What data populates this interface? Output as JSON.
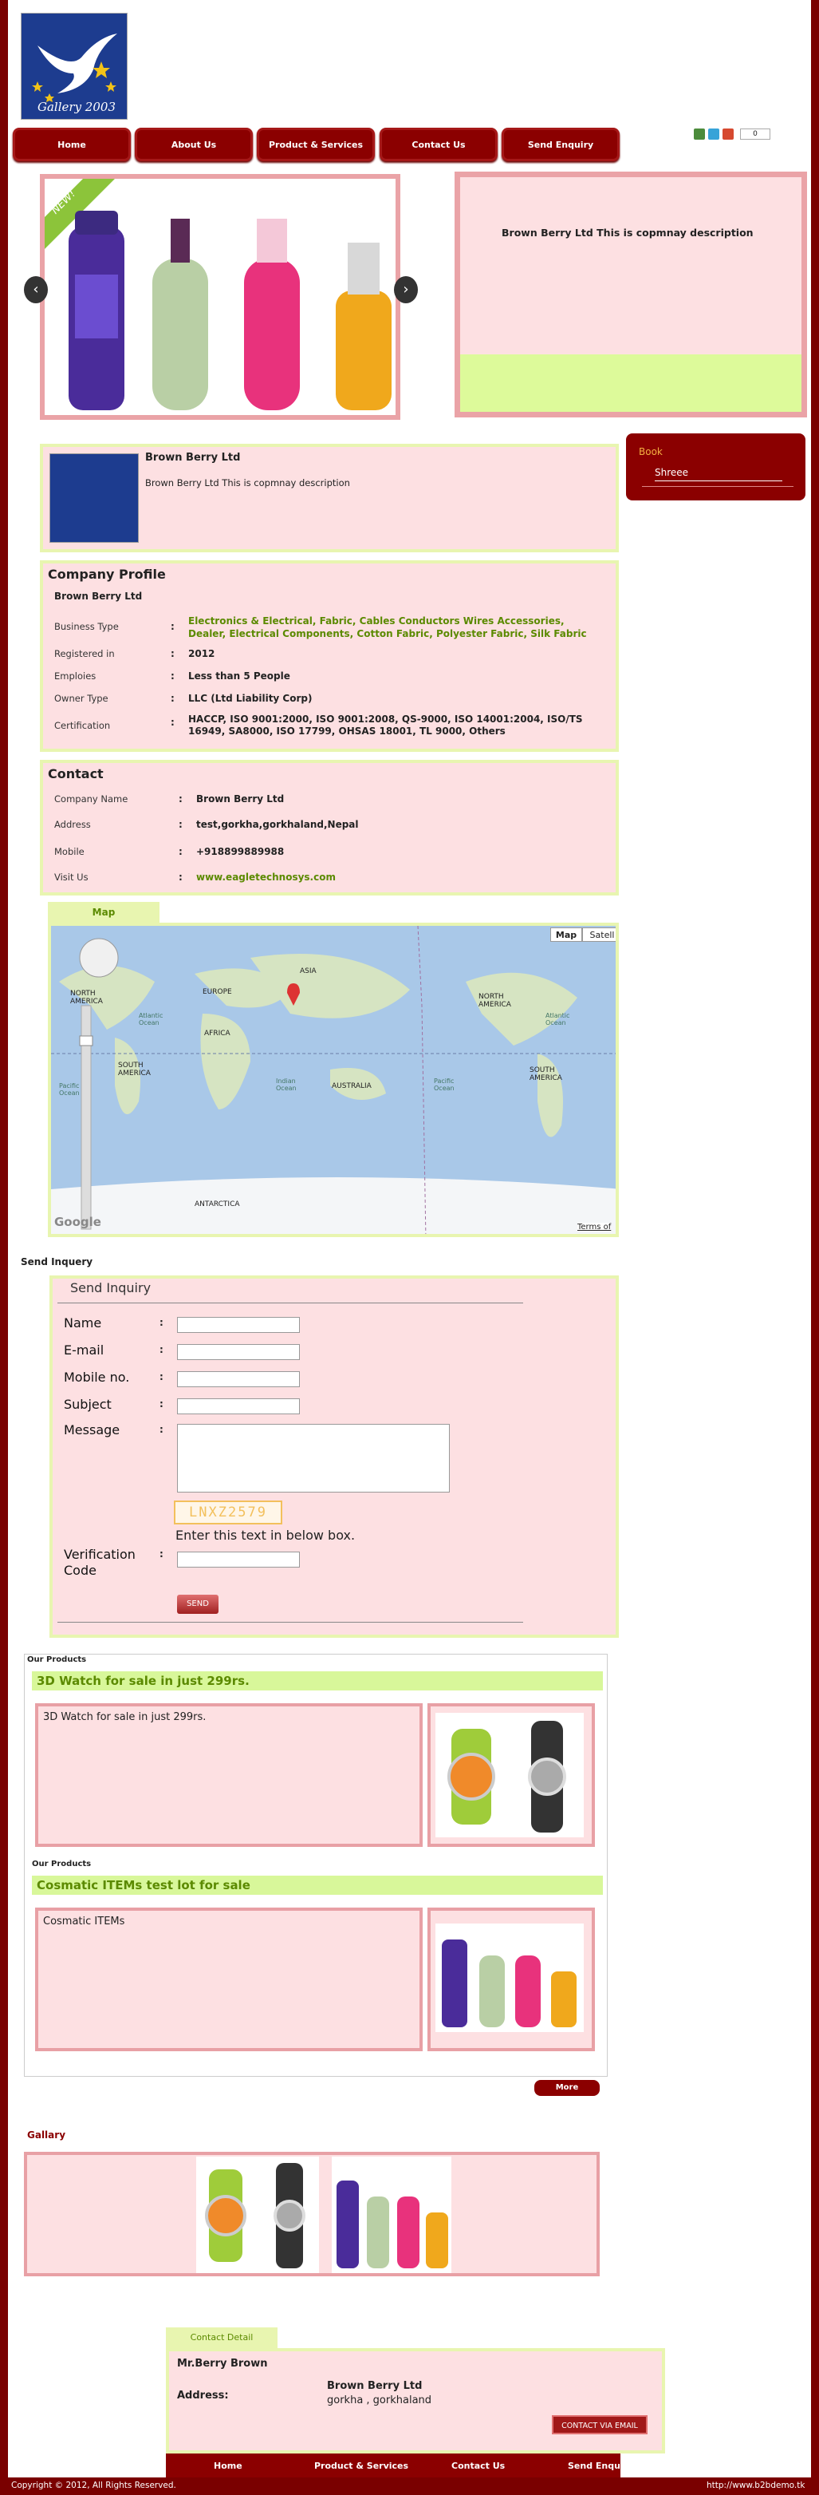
{
  "header": {
    "logo_text": "Gallery 2003",
    "share_count": "0"
  },
  "nav": [
    {
      "label": "Home"
    },
    {
      "label": "About Us"
    },
    {
      "label": "Product & Services"
    },
    {
      "label": "Contact Us"
    },
    {
      "label": "Send Enquiry"
    }
  ],
  "banner": {
    "ribbon": "NEW!",
    "description": "Brown Berry Ltd This is copmnay description"
  },
  "company_card": {
    "name": "Brown Berry Ltd",
    "description": "Brown Berry Ltd This is copmnay description"
  },
  "book": {
    "title": "Book",
    "item": "Shreee"
  },
  "profile": {
    "heading": "Company Profile",
    "company": "Brown Berry Ltd",
    "rows": [
      {
        "label": "Business Type",
        "value": "Electronics & Electrical, Fabric, Cables Conductors Wires Accessories, Dealer, Electrical Components, Cotton Fabric, Polyester Fabric, Silk Fabric"
      },
      {
        "label": "Registered in",
        "value": "2012"
      },
      {
        "label": "Emploies",
        "value": "Less than 5 People"
      },
      {
        "label": "Owner Type",
        "value": "LLC (Ltd Liability Corp)"
      },
      {
        "label": "Certification",
        "value": "HACCP, ISO 9001:2000, ISO 9001:2008, QS-9000, ISO 14001:2004, ISO/TS 16949, SA8000, ISO 17799, OHSAS 18001, TL 9000, Others"
      }
    ]
  },
  "contact": {
    "heading": "Contact",
    "rows": [
      {
        "label": "Company Name",
        "value": "Brown Berry Ltd"
      },
      {
        "label": "Address",
        "value": "test,gorkha,gorkhaland,Nepal"
      },
      {
        "label": "Mobile",
        "value": "+918899889988"
      },
      {
        "label": "Visit Us",
        "value": "www.eagletechnosys.com"
      }
    ]
  },
  "map": {
    "tab": "Map",
    "type_map": "Map",
    "type_sat": "Satell",
    "labels": [
      "NORTH AMERICA",
      "EUROPE",
      "ASIA",
      "AFRICA",
      "SOUTH AMERICA",
      "AUSTRALIA",
      "ANTARCTICA",
      "NORTH AMERICA",
      "SOUTH AMERICA"
    ],
    "oceans": [
      "Atlantic Ocean",
      "Pacific Ocean",
      "Indian Ocean",
      "Pacific Ocean",
      "Atlantic Ocean"
    ],
    "google": "Google",
    "terms": "Terms of"
  },
  "inquiry": {
    "section_title": "Send Inquery",
    "box_title": "Send Inquiry",
    "fields": [
      "Name",
      "E-mail",
      "Mobile no.",
      "Subject",
      "Message"
    ],
    "captcha": "LNXZ2579",
    "captcha_hint": "Enter this text in below box.",
    "verification": "Verification Code",
    "send": "SEND"
  },
  "products": [
    {
      "section": "Our Products",
      "title": "3D Watch for sale in just 299rs.",
      "description": "3D Watch for sale in just 299rs."
    },
    {
      "section": "Our Products",
      "title": "Cosmatic ITEMs test lot for sale",
      "description": "Cosmatic ITEMs"
    }
  ],
  "more": "More",
  "gallery": {
    "title": "Gallary"
  },
  "contact_detail": {
    "tab": "Contact Detail",
    "person": "Mr.Berry Brown",
    "address_label": "Address:",
    "company": "Brown Berry Ltd",
    "address": "gorkha , gorkhaland",
    "email_btn": "CONTACT VIA EMAIL"
  },
  "footer": {
    "nav": [
      "Home",
      "Product & Services",
      "Contact Us",
      "Send Enquiry"
    ],
    "copyright": "Copyright © 2012, All Rights Reserved.",
    "url": "http://www.b2bdemo.tk"
  },
  "colors": {
    "brand": "#8b0000",
    "accent": "#e8f5b0",
    "pink": "#fde0e2",
    "link": "#5b8a00"
  }
}
